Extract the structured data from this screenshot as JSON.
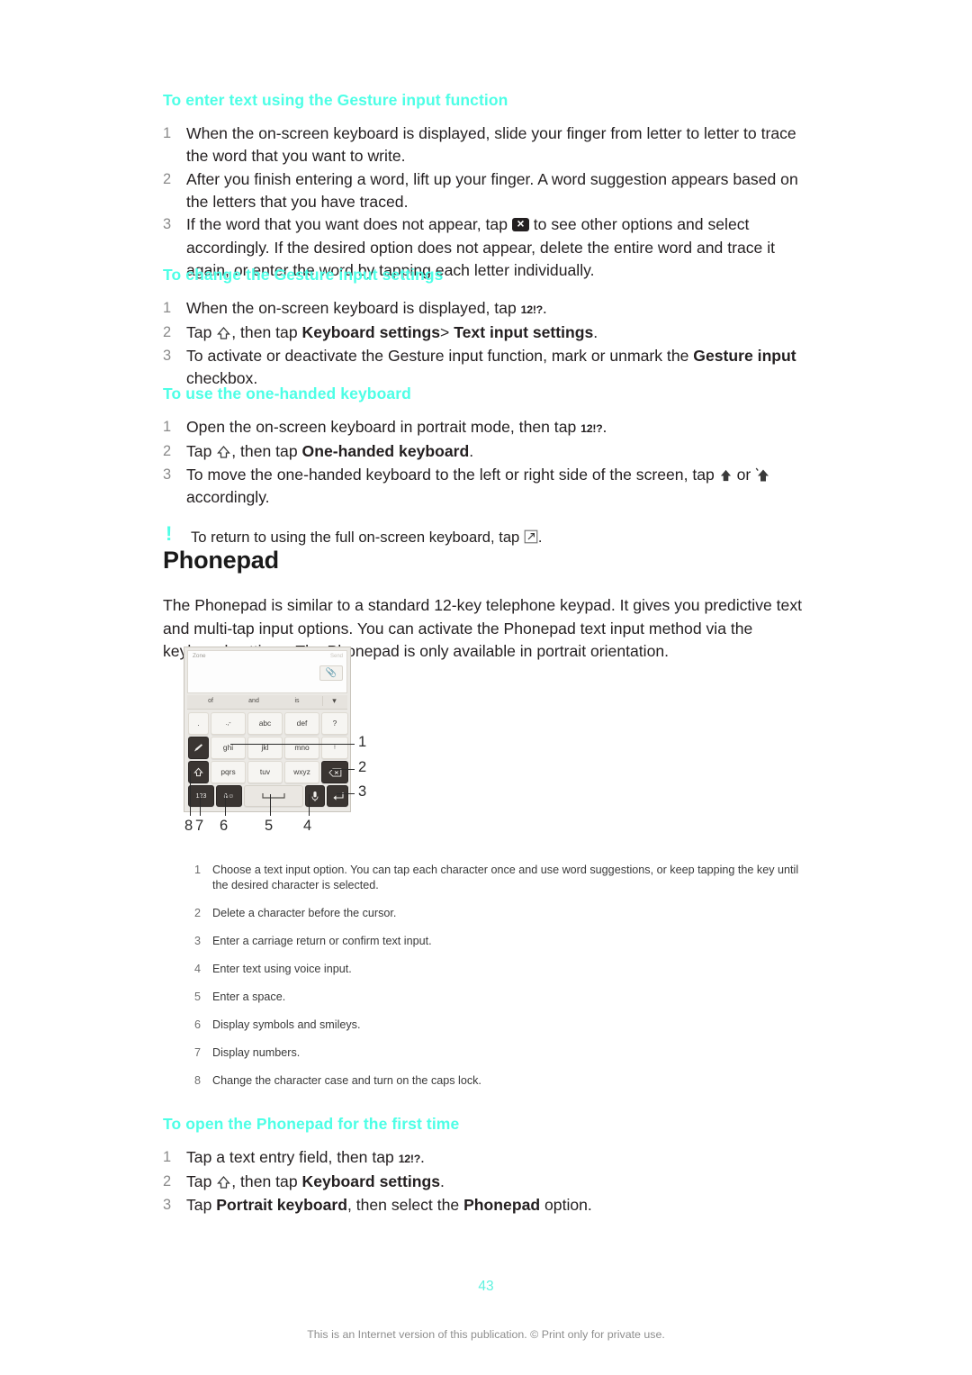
{
  "document": {
    "page_number": "43",
    "footer_note": "This is an Internet version of this publication. © Print only for private use.",
    "heading_color": "#4dffe6"
  },
  "section_gesture_input": {
    "heading": "To enter text using the Gesture input function",
    "steps": [
      "When the on-screen keyboard is displayed, slide your finger from letter to letter to trace the word that you want to write.",
      "After you finish entering a word, lift up your finger. A word suggestion appears based on the letters that you have traced.",
      "If the word that you want does not appear, tap  to see other options and select accordingly. If the desired option does not appear, delete the entire word and trace it again, or enter the word by tapping each letter individually."
    ],
    "step3_part1": "If the word that you want does not appear, tap ",
    "step3_part2": " to see other options and select accordingly. If the desired option does not appear, delete the entire word and trace it again, or enter the word by tapping each letter individually."
  },
  "section_gesture_settings": {
    "heading": "To change the Gesture input settings",
    "step1_part1": "When the on-screen keyboard is displayed, tap ",
    "step1_glyph": "12!?",
    "step1_part2": ".",
    "step2_part1": "Tap ",
    "step2_part2": ", then tap ",
    "step2_bold1": "Keyboard settings",
    "step2_mid": "> ",
    "step2_bold2": "Text input settings",
    "step2_part3": ".",
    "step3_part1": "To activate or deactivate the Gesture input function, mark or unmark the ",
    "step3_bold1": "Gesture input",
    "step3_part2": " checkbox."
  },
  "section_one_handed": {
    "heading": "To use the one-handed keyboard",
    "step1_part1": "Open the on-screen keyboard in portrait mode, then tap ",
    "step1_glyph": "12!?",
    "step1_part2": ".",
    "step2_part1": "Tap ",
    "step2_part2": ", then tap ",
    "step2_bold1": "One-handed keyboard",
    "step2_part3": ".",
    "step3_part1": "To move the one-handed keyboard to the left or right side of the screen, tap ",
    "step3_mid": " or ",
    "step3_part2": " accordingly.",
    "note_part1": "To return to using the full on-screen keyboard, tap ",
    "note_part2": ".",
    "note_marker": "!"
  },
  "section_phonepad": {
    "title": "Phonepad",
    "intro": "The Phonepad is similar to a standard 12-key telephone keypad. It gives you predictive text and multi-tap input options. You can activate the Phonepad text input method via the keyboard settings. The Phonepad is only available in portrait orientation.",
    "figure": {
      "field_placeholder": "Zone",
      "send_label": "Send",
      "attach_icon": "paperclip-icon",
      "suggestions": [
        "of",
        "and",
        "is"
      ],
      "suggestion_expand_icon": "chevron-down-icon",
      "keys_row1": [
        ".",
        ".,-",
        "abc",
        "def",
        "?"
      ],
      "keys_row2": [
        "pen-icon",
        "ghi",
        "jkl",
        "mno",
        "!"
      ],
      "keys_row3": [
        "shift-icon",
        "pqrs",
        "tuv",
        "wxyz",
        "backspace-icon"
      ],
      "keys_row4": [
        "123",
        "&-smiley-icon",
        "space-icon",
        "microphone-icon",
        "enter-icon"
      ],
      "callout_numbers_right": [
        "1",
        "2",
        "3"
      ],
      "callout_numbers_bottom": [
        "8",
        "7",
        "6",
        "5",
        "4"
      ]
    },
    "legend": [
      "Choose a text input option. You can tap each character once and use word suggestions, or keep tapping the key until the desired character is selected.",
      "Delete a character before the cursor.",
      "Enter a carriage return or confirm text input.",
      "Enter text using voice input.",
      "Enter a space.",
      "Display symbols and smileys.",
      "Display numbers.",
      "Change the character case and turn on the caps lock."
    ]
  },
  "section_open_phonepad": {
    "heading": "To open the Phonepad for the first time",
    "step1_part1": "Tap a text entry field, then tap ",
    "step1_glyph": "12!?",
    "step1_part2": ".",
    "step2_part1": "Tap ",
    "step2_part2": ", then tap ",
    "step2_bold1": "Keyboard settings",
    "step2_part3": ".",
    "step3_part1": "Tap ",
    "step3_bold1": "Portrait keyboard",
    "step3_mid": ", then select the ",
    "step3_bold2": "Phonepad",
    "step3_part2": " option."
  }
}
